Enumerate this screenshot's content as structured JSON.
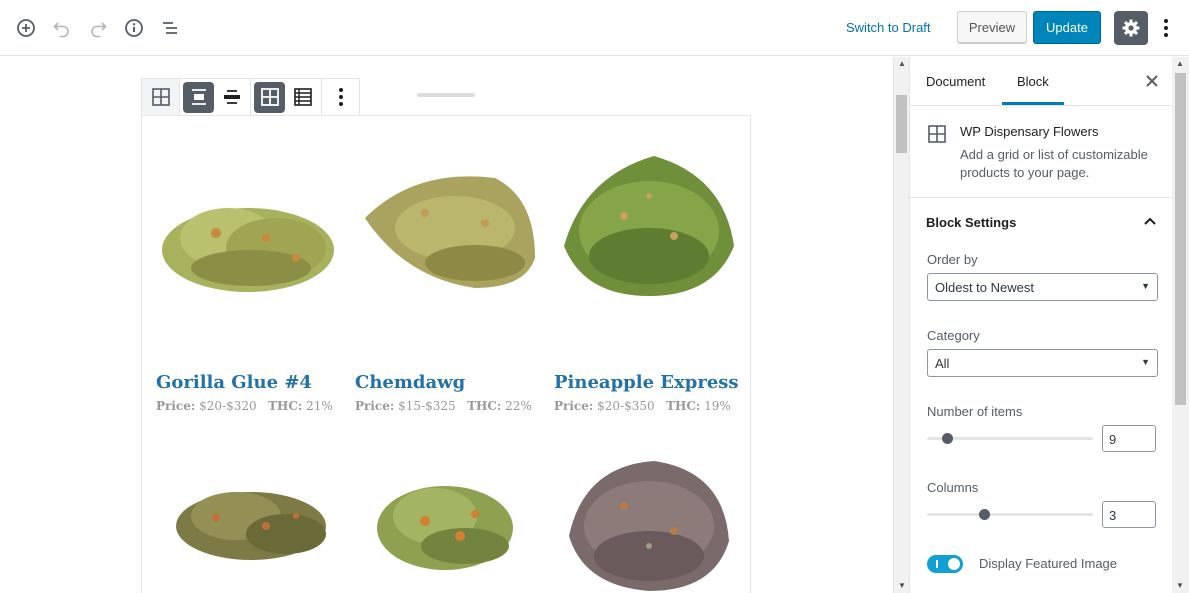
{
  "topbar": {
    "switch_draft": "Switch to Draft",
    "preview": "Preview",
    "update": "Update",
    "accent": "#0085ba"
  },
  "products": [
    {
      "name": "Gorilla Glue #4",
      "price_label": "Price:",
      "price": "$20-$320",
      "thc_label": "THC:",
      "thc": "21%"
    },
    {
      "name": "Chemdawg",
      "price_label": "Price:",
      "price": "$15-$325",
      "thc_label": "THC:",
      "thc": "22%"
    },
    {
      "name": "Pineapple Express",
      "price_label": "Price:",
      "price": "$20-$350",
      "thc_label": "THC:",
      "thc": "19%"
    },
    {
      "name": "",
      "price_label": "",
      "price": "",
      "thc_label": "",
      "thc": ""
    },
    {
      "name": "",
      "price_label": "",
      "price": "",
      "thc_label": "",
      "thc": ""
    },
    {
      "name": "",
      "price_label": "",
      "price": "",
      "thc_label": "",
      "thc": ""
    }
  ],
  "sidebar": {
    "tabs": [
      {
        "label": "Document"
      },
      {
        "label": "Block"
      }
    ],
    "active_tab": "Block",
    "block": {
      "title": "WP Dispensary Flowers",
      "description": "Add a grid or list of customizable products to your page."
    },
    "panel_title": "Block Settings",
    "order_by": {
      "label": "Order by",
      "value": "Oldest to Newest"
    },
    "category": {
      "label": "Category",
      "value": "All"
    },
    "number_of_items": {
      "label": "Number of items",
      "value": "9",
      "slider_fraction": 0.12
    },
    "columns": {
      "label": "Columns",
      "value": "3",
      "slider_fraction": 0.35
    },
    "display_featured_image": {
      "label": "Display Featured Image",
      "enabled": true
    }
  }
}
